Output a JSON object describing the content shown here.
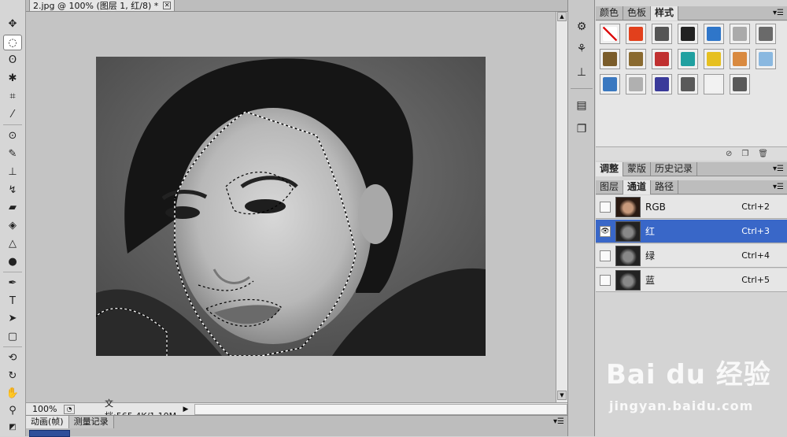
{
  "document": {
    "tab_title": "2.jpg @ 100% (图层 1, 红/8) *",
    "zoom": "100%",
    "doc_info": "文档:565.4K/1.10M"
  },
  "bottom_panel": {
    "tabs": [
      "动画(帧)",
      "测量记录"
    ]
  },
  "styles_panel": {
    "tabs": [
      "颜色",
      "色板",
      "样式"
    ],
    "active_tab": "样式",
    "swatch_colors": [
      "#ffffff",
      "#e2401c",
      "#555555",
      "#222222",
      "#2f76c9",
      "#aaaaaa",
      "#6a6a6a",
      "#7a5c2a",
      "#8a6a30",
      "#c03030",
      "#20a0a0",
      "#e6c020",
      "#d98a40",
      "#8ab8e0",
      "#3a78c0",
      "#b0b0b0",
      "#3a3a9a",
      "#5a5a5a",
      "#f2f2f2",
      "#5a5a5a"
    ]
  },
  "adjust_panel": {
    "tabs": [
      "调整",
      "蒙版",
      "历史记录"
    ]
  },
  "channels_panel": {
    "tabs": [
      "图层",
      "通道",
      "路径"
    ],
    "active_tab": "通道",
    "rows": [
      {
        "name": "RGB",
        "shortcut": "Ctrl+2",
        "visible": false,
        "selected": false
      },
      {
        "name": "红",
        "shortcut": "Ctrl+3",
        "visible": true,
        "selected": true
      },
      {
        "name": "绿",
        "shortcut": "Ctrl+4",
        "visible": false,
        "selected": false
      },
      {
        "name": "蓝",
        "shortcut": "Ctrl+5",
        "visible": false,
        "selected": false
      }
    ]
  },
  "watermark": {
    "brand": "Bai du 经验",
    "url": "jingyan.baidu.com"
  },
  "icons": {
    "tools": [
      "move-icon",
      "marquee-icon",
      "lasso-icon",
      "magic-wand-icon",
      "crop-icon",
      "eyedropper-icon",
      "red-eye-icon",
      "brush-icon",
      "stamp-icon",
      "history-brush-icon",
      "eraser-icon",
      "bucket-icon",
      "blur-icon",
      "dodge-icon",
      "pen-icon",
      "type-icon",
      "path-select-icon",
      "shape-icon",
      "3d-rotate-icon",
      "3d-orbit-icon",
      "hand-icon",
      "zoom-icon"
    ]
  }
}
